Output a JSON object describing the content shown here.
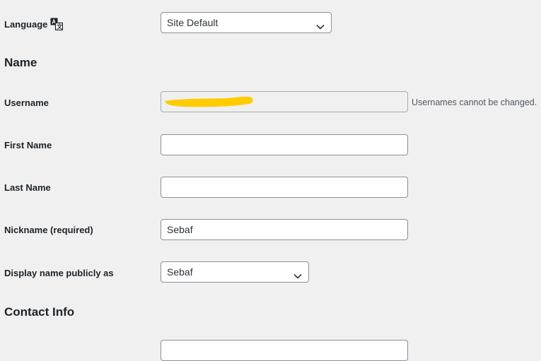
{
  "language": {
    "label": "Language",
    "icon": "translate-icon",
    "selected": "Site Default"
  },
  "name_section": {
    "heading": "Name"
  },
  "username": {
    "label": "Username",
    "value": "",
    "description": "Usernames cannot be changed."
  },
  "first_name": {
    "label": "First Name",
    "value": ""
  },
  "last_name": {
    "label": "Last Name",
    "value": ""
  },
  "nickname": {
    "label": "Nickname (required)",
    "value": "Sebaf"
  },
  "display_name": {
    "label": "Display name publicly as",
    "selected": "Sebaf"
  },
  "contact_section": {
    "heading": "Contact Info"
  },
  "colors": {
    "background": "#f0f0f1",
    "border": "#8c8f94",
    "redaction": "#ffcc00"
  }
}
